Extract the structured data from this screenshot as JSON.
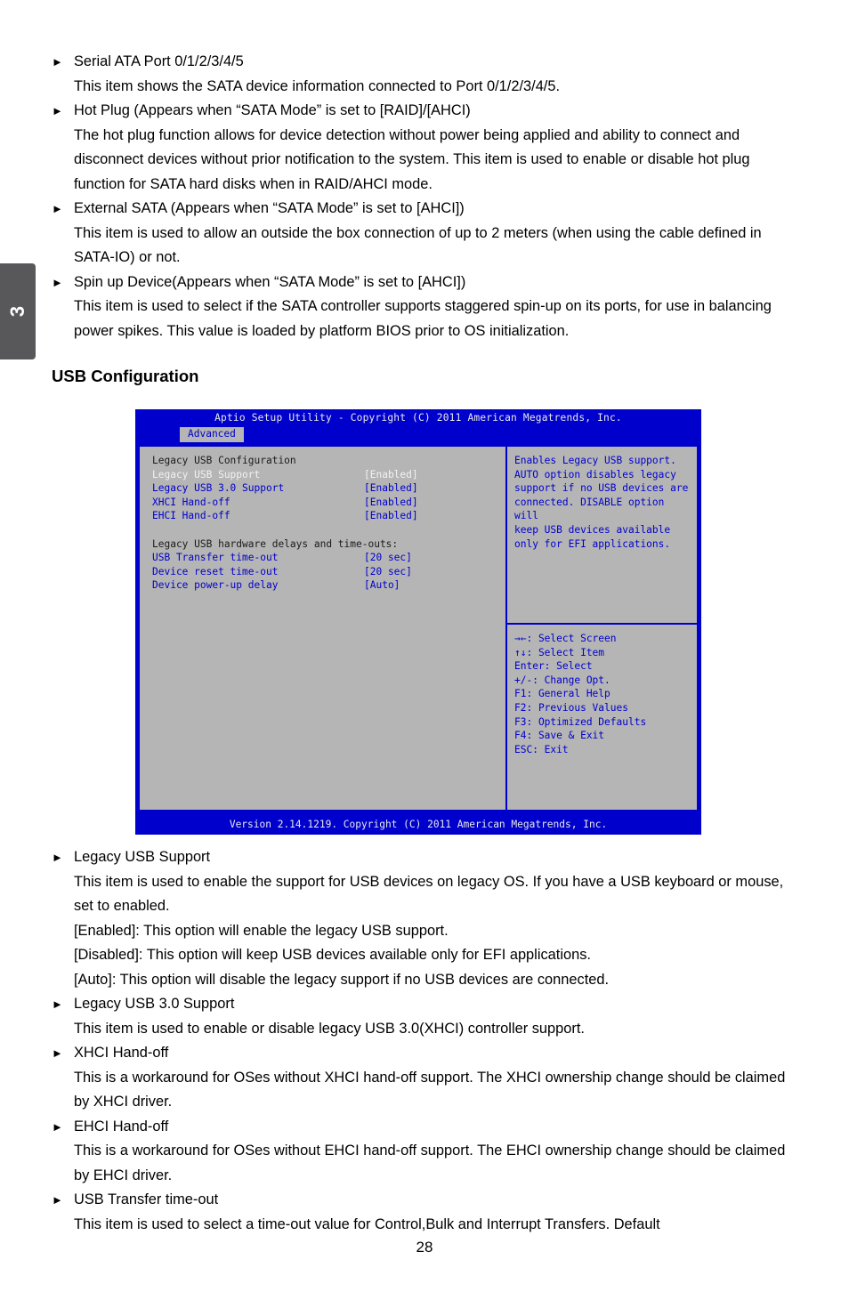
{
  "chapter_tab": {
    "number": "3"
  },
  "page_number": "28",
  "top_items": [
    {
      "marker": "►",
      "title": "Serial ATA Port 0/1/2/3/4/5",
      "body": "This item shows the SATA device information connected to Port 0/1/2/3/4/5."
    },
    {
      "marker": "►",
      "title": "Hot Plug (Appears when “SATA Mode” is set to [RAID]/[AHCI)",
      "body": "The hot plug function allows for device detection without power being applied and ability to connect and disconnect devices without prior notification to the system. This item is used to enable or disable hot plug function for SATA hard disks when in RAID/AHCI mode."
    },
    {
      "marker": "►",
      "title": "External SATA (Appears when “SATA Mode” is set to [AHCI])",
      "body": "This item is used to allow an outside the box connection of up to 2 meters (when using the cable defined in SATA-IO) or not."
    },
    {
      "marker": "►",
      "title": "Spin up Device(Appears when “SATA Mode” is set to [AHCI])",
      "body": "This item is used to select if the SATA controller supports staggered spin-up on its ports, for use in balancing power spikes. This value is loaded by platform BIOS prior to OS initialization."
    }
  ],
  "section_heading": "USB Configuration",
  "bios": {
    "title": "Aptio Setup Utility - Copyright (C) 2011 American Megatrends, Inc.",
    "tab": "Advanced",
    "group_header": "Legacy USB Configuration",
    "settings": [
      {
        "label": "Legacy USB Support",
        "value": "[Enabled]",
        "selected": true
      },
      {
        "label": "Legacy USB 3.0 Support",
        "value": "[Enabled]",
        "selected": false
      },
      {
        "label": "XHCI Hand-off",
        "value": "[Enabled]",
        "selected": false
      },
      {
        "label": "EHCI Hand-off",
        "value": "[Enabled]",
        "selected": false
      }
    ],
    "delays_header": "Legacy USB hardware delays and time-outs:",
    "delays": [
      {
        "label": "USB Transfer time-out",
        "value": "[20 sec]"
      },
      {
        "label": "Device reset time-out",
        "value": "[20 sec]"
      },
      {
        "label": "Device power-up delay",
        "value": "[Auto]"
      }
    ],
    "help_lines": [
      "Enables Legacy USB support.",
      "AUTO option disables legacy",
      "support if no USB devices are",
      "connected. DISABLE option will",
      "keep USB devices available",
      "only for EFI applications."
    ],
    "nav_lines": [
      "→←: Select Screen",
      "↑↓: Select Item",
      "Enter: Select",
      "+/-: Change Opt.",
      "F1: General Help",
      "F2: Previous Values",
      "F3: Optimized Defaults",
      "F4: Save & Exit",
      "ESC: Exit"
    ],
    "footer": "Version 2.14.1219. Copyright (C) 2011 American Megatrends, Inc.",
    "colors": {
      "background_blue": "#0000CC",
      "panel_gray": "#B5B5B5",
      "title_text": "#E8E8E8",
      "selected_row": "#F2F2F2"
    }
  },
  "lower_items": [
    {
      "marker": "►",
      "title": "Legacy USB Support",
      "lines": [
        "This item is used to enable the support for USB devices on legacy OS. If you have a USB keyboard or mouse, set to enabled.",
        "[Enabled]: This option will enable the legacy USB support.",
        "[Disabled]: This option will keep USB devices available only for EFI applications.",
        "[Auto]: This option will disable the legacy support if no USB devices are connected."
      ]
    },
    {
      "marker": "►",
      "title": "Legacy USB 3.0 Support",
      "lines": [
        "This item is used to enable or disable legacy USB 3.0(XHCI) controller support."
      ]
    },
    {
      "marker": "►",
      "title": "XHCI Hand-off",
      "lines": [
        "This is a workaround for OSes without XHCI hand-off support. The XHCI ownership change should be claimed by XHCI driver."
      ]
    },
    {
      "marker": "►",
      "title": "EHCI Hand-off",
      "lines": [
        "This is a workaround for OSes without EHCI hand-off support. The EHCI ownership change should be claimed by EHCI driver."
      ]
    },
    {
      "marker": "►",
      "title": "USB Transfer time-out",
      "lines": [
        "This item is used to select a time-out value for Control,Bulk and Interrupt Transfers. Default"
      ]
    }
  ]
}
